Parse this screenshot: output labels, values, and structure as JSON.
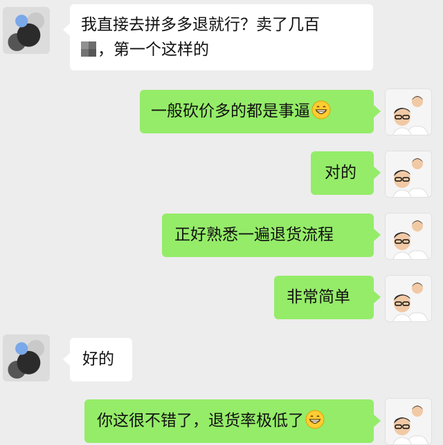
{
  "messages": [
    {
      "side": "in",
      "line1": "我直接去拼多多退就行？卖了几百",
      "line2": "，第一个这样的"
    },
    {
      "side": "out",
      "text": "一般砍价多的都是事逼",
      "emoji": "grinning-face-emoji"
    },
    {
      "side": "out",
      "text": "对的"
    },
    {
      "side": "out",
      "text": "正好熟悉一遍退货流程"
    },
    {
      "side": "out",
      "text": "非常简单"
    },
    {
      "side": "in",
      "text": "好的"
    },
    {
      "side": "out",
      "text": "你这很不错了，退货率极低了",
      "emoji": "grinning-face-emoji"
    }
  ],
  "colors": {
    "background": "#ededed",
    "incoming_bubble": "#ffffff",
    "outgoing_bubble": "#95ec69"
  }
}
